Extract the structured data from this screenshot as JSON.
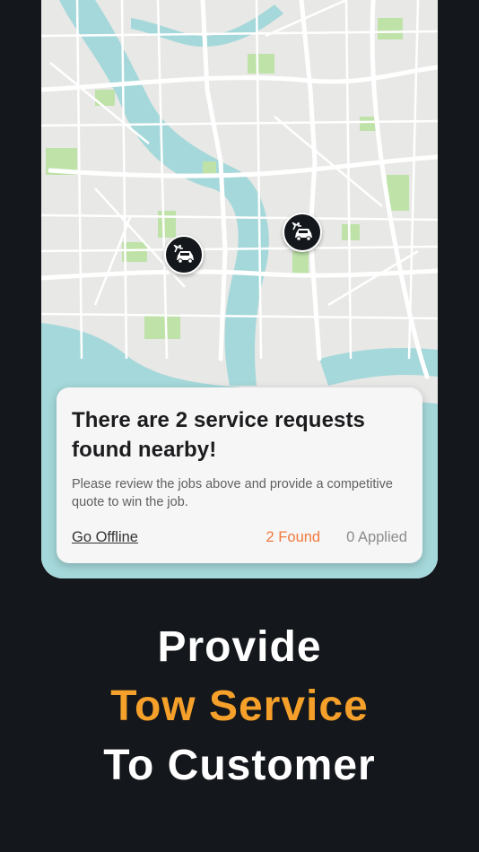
{
  "map": {
    "pins": [
      {
        "name": "tow-request-pin-1",
        "icon": "car-crash-icon"
      },
      {
        "name": "tow-request-pin-2",
        "icon": "car-crash-icon"
      }
    ],
    "colors": {
      "land": "#e8e8e6",
      "water": "#a5d8da",
      "park": "#bfe2a9",
      "road": "#ffffff"
    }
  },
  "card": {
    "title": "There are 2 service requests found nearby!",
    "description": "Please review the jobs above and provide a competitive quote to win the job.",
    "go_offline": "Go Offline",
    "found": "2 Found",
    "applied": "0 Applied"
  },
  "headline": {
    "line1": "Provide",
    "line2": "Tow Service",
    "line3": "To Customer"
  },
  "colors": {
    "background": "#14171b",
    "accent": "#f5a02a",
    "found": "#f07a3b"
  }
}
